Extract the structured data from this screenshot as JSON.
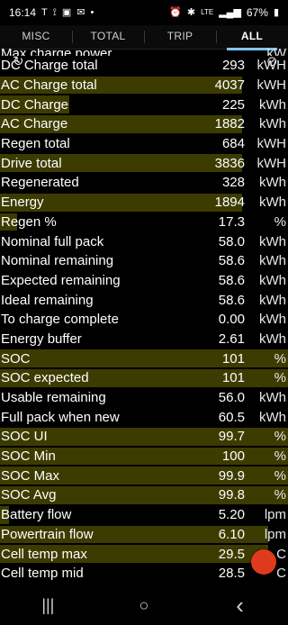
{
  "status_bar": {
    "time": "16:14",
    "left_icons": [
      "tesla-icon",
      "signal-icon",
      "image-icon",
      "mail-icon"
    ],
    "dot": "•",
    "battery_percent": "67%",
    "right_icons": [
      "alarm-icon",
      "bluetooth-icon",
      "lte-icon",
      "signal-bars-icon",
      "battery-icon"
    ]
  },
  "tabs": [
    {
      "label": "MISC",
      "active": false
    },
    {
      "label": "TOTAL",
      "active": false
    },
    {
      "label": "TRIP",
      "active": false
    },
    {
      "label": "ALL",
      "active": true
    }
  ],
  "rows": [
    {
      "label": "Max charge power",
      "value": "",
      "unit": "kW",
      "fill": 0.0,
      "partial": true
    },
    {
      "label": "DC Charge total",
      "value": "293",
      "unit": "kWH",
      "fill": 0.0
    },
    {
      "label": "AC Charge total",
      "value": "4037",
      "unit": "kWH",
      "fill": 0.84
    },
    {
      "label": "DC Charge",
      "value": "225",
      "unit": "kWh",
      "fill": 0.24
    },
    {
      "label": "AC Charge",
      "value": "1882",
      "unit": "kWh",
      "fill": 0.84
    },
    {
      "label": "Regen total",
      "value": "684",
      "unit": "kWH",
      "fill": 0.0
    },
    {
      "label": "Drive total",
      "value": "3836",
      "unit": "kWH",
      "fill": 0.84
    },
    {
      "label": "Regenerated",
      "value": "328",
      "unit": "kWh",
      "fill": 0.0
    },
    {
      "label": "Energy",
      "value": "1894",
      "unit": "kWh",
      "fill": 0.84
    },
    {
      "label": "Regen %",
      "value": "17.3",
      "unit": "%",
      "fill": 0.06
    },
    {
      "label": "Nominal full pack",
      "value": "58.0",
      "unit": "kWh",
      "fill": 0.0
    },
    {
      "label": "Nominal remaining",
      "value": "58.6",
      "unit": "kWh",
      "fill": 0.0
    },
    {
      "label": "Expected remaining",
      "value": "58.6",
      "unit": "kWh",
      "fill": 0.0
    },
    {
      "label": "Ideal remaining",
      "value": "58.6",
      "unit": "kWh",
      "fill": 0.0
    },
    {
      "label": "To charge complete",
      "value": "0.00",
      "unit": "kWh",
      "fill": 0.0
    },
    {
      "label": "Energy buffer",
      "value": "2.61",
      "unit": "kWh",
      "fill": 0.0
    },
    {
      "label": "SOC",
      "value": "101",
      "unit": "%",
      "fill": 1.0
    },
    {
      "label": "SOC expected",
      "value": "101",
      "unit": "%",
      "fill": 1.0
    },
    {
      "label": "Usable remaining",
      "value": "56.0",
      "unit": "kWh",
      "fill": 0.0
    },
    {
      "label": "Full pack when new",
      "value": "60.5",
      "unit": "kWh",
      "fill": 0.0
    },
    {
      "label": "SOC UI",
      "value": "99.7",
      "unit": "%",
      "fill": 1.0
    },
    {
      "label": "SOC Min",
      "value": "100",
      "unit": "%",
      "fill": 1.0
    },
    {
      "label": "SOC Max",
      "value": "99.9",
      "unit": "%",
      "fill": 1.0
    },
    {
      "label": "SOC Avg",
      "value": "99.8",
      "unit": "%",
      "fill": 1.0
    },
    {
      "label": "Battery flow",
      "value": "5.20",
      "unit": "lpm",
      "fill": 0.03
    },
    {
      "label": "Powertrain flow",
      "value": "6.10",
      "unit": "lpm",
      "fill": 0.93
    },
    {
      "label": "Cell temp max",
      "value": "29.5",
      "unit": "C",
      "fill": 0.93
    },
    {
      "label": "Cell temp mid",
      "value": "28.5",
      "unit": "C",
      "fill": 0.0
    }
  ],
  "nav": {
    "recents": "|||",
    "home": "○",
    "back": "‹"
  }
}
